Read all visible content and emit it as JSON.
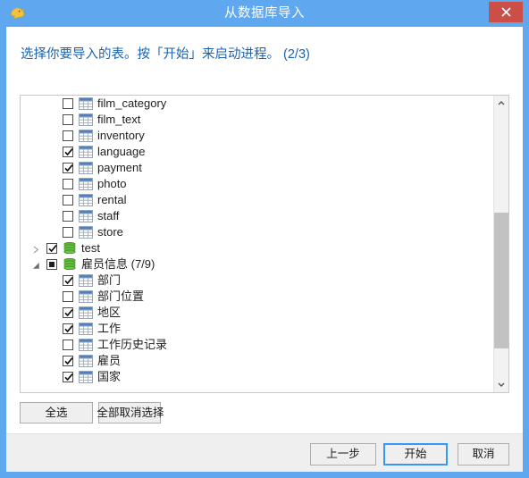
{
  "window": {
    "title": "从数据库导入",
    "app_icon": "dolphin-icon",
    "close_label": "✕",
    "accent_blue": "#5fa7ee",
    "close_red": "#cc4f47"
  },
  "header": {
    "instruction": "选择你要导入的表。按「开始」来启动进程。 (2/3)",
    "text_color": "#1b63b0"
  },
  "list": {
    "rows": [
      {
        "label": "film_category",
        "level": 1,
        "icon": "table-icon",
        "checked": "unchecked",
        "expander": ""
      },
      {
        "label": "film_text",
        "level": 1,
        "icon": "table-icon",
        "checked": "unchecked",
        "expander": ""
      },
      {
        "label": "inventory",
        "level": 1,
        "icon": "table-icon",
        "checked": "unchecked",
        "expander": ""
      },
      {
        "label": "language",
        "level": 1,
        "icon": "table-icon",
        "checked": "checked",
        "expander": ""
      },
      {
        "label": "payment",
        "level": 1,
        "icon": "table-icon",
        "checked": "checked",
        "expander": ""
      },
      {
        "label": "photo",
        "level": 1,
        "icon": "table-icon",
        "checked": "unchecked",
        "expander": ""
      },
      {
        "label": "rental",
        "level": 1,
        "icon": "table-icon",
        "checked": "unchecked",
        "expander": ""
      },
      {
        "label": "staff",
        "level": 1,
        "icon": "table-icon",
        "checked": "unchecked",
        "expander": ""
      },
      {
        "label": "store",
        "level": 1,
        "icon": "table-icon",
        "checked": "unchecked",
        "expander": ""
      },
      {
        "label": "test",
        "level": 0,
        "icon": "database-icon",
        "checked": "checked",
        "expander": "collapsed"
      },
      {
        "label": "雇员信息 (7/9)",
        "level": 0,
        "icon": "database-icon",
        "checked": "partial",
        "expander": "expanded"
      },
      {
        "label": "部门",
        "level": 1,
        "icon": "table-icon",
        "checked": "checked",
        "expander": ""
      },
      {
        "label": "部门位置",
        "level": 1,
        "icon": "table-icon",
        "checked": "unchecked",
        "expander": ""
      },
      {
        "label": "地区",
        "level": 1,
        "icon": "table-icon",
        "checked": "checked",
        "expander": ""
      },
      {
        "label": "工作",
        "level": 1,
        "icon": "table-icon",
        "checked": "checked",
        "expander": ""
      },
      {
        "label": "工作历史记录",
        "level": 1,
        "icon": "table-icon",
        "checked": "unchecked",
        "expander": ""
      },
      {
        "label": "雇员",
        "level": 1,
        "icon": "table-icon",
        "checked": "checked",
        "expander": ""
      },
      {
        "label": "国家",
        "level": 1,
        "icon": "table-icon",
        "checked": "checked",
        "expander": ""
      }
    ],
    "scrollbar": {
      "up_arrow": "▲",
      "down_arrow": "▼"
    }
  },
  "selection_buttons": {
    "select_all": "全选",
    "deselect_all": "全部取消选择"
  },
  "footer": {
    "prev": "上一步",
    "start": "开始",
    "cancel": "取消"
  }
}
